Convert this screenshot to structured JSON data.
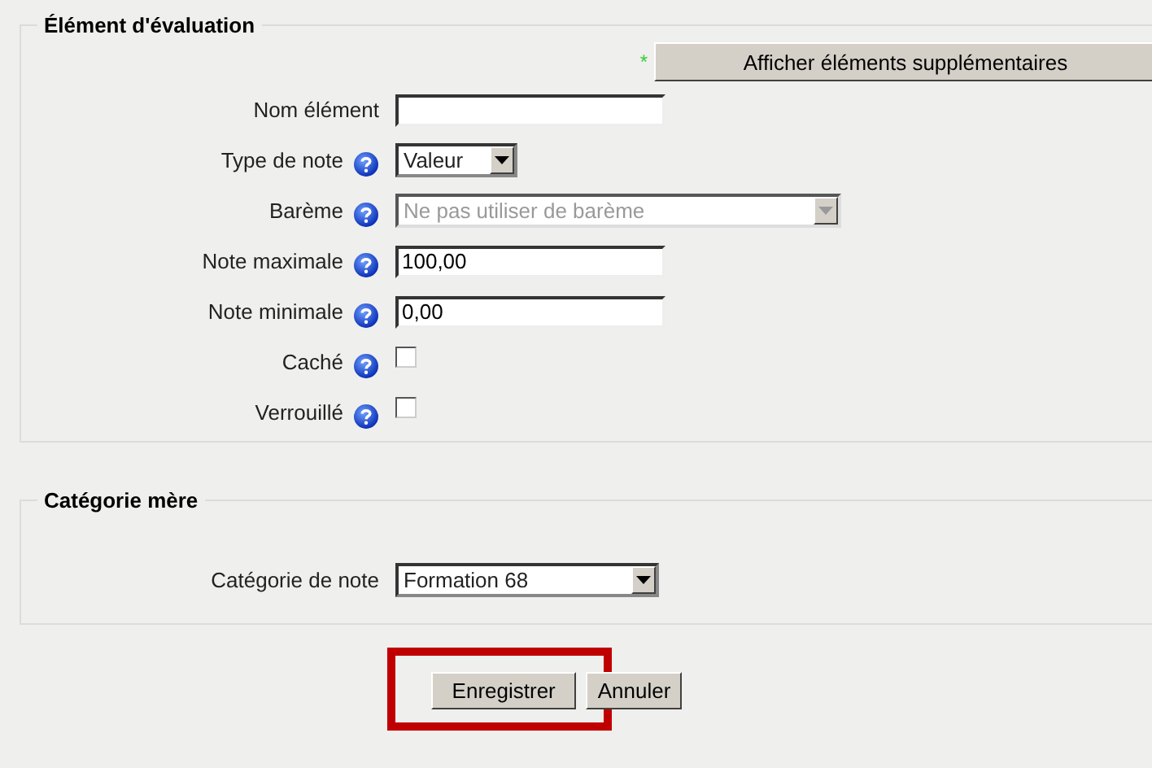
{
  "sections": [
    {
      "legend": "Élément d'évaluation",
      "extra_button": {
        "mark": "*",
        "label": "Afficher éléments supplémentaires"
      },
      "rows": [
        {
          "kind": "text",
          "label": "Nom élément",
          "help": false,
          "value": ""
        },
        {
          "kind": "select",
          "label": "Type de note",
          "help": true,
          "value": "Valeur",
          "disabled": false
        },
        {
          "kind": "select",
          "label": "Barème",
          "help": true,
          "value": "Ne pas utiliser de barème",
          "disabled": true
        },
        {
          "kind": "text",
          "label": "Note maximale",
          "help": true,
          "value": "100,00"
        },
        {
          "kind": "text",
          "label": "Note minimale",
          "help": true,
          "value": "0,00"
        },
        {
          "kind": "checkbox",
          "label": "Caché",
          "help": true,
          "checked": false
        },
        {
          "kind": "checkbox",
          "label": "Verrouillé",
          "help": true,
          "checked": false
        }
      ]
    },
    {
      "legend": "Catégorie mère",
      "rows": [
        {
          "kind": "select",
          "label": "Catégorie de note",
          "help": false,
          "value": "Formation 68",
          "disabled": false
        }
      ]
    }
  ],
  "buttons": [
    {
      "label": "Enregistrer",
      "highlighted": true
    },
    {
      "label": "Annuler",
      "highlighted": false
    }
  ]
}
